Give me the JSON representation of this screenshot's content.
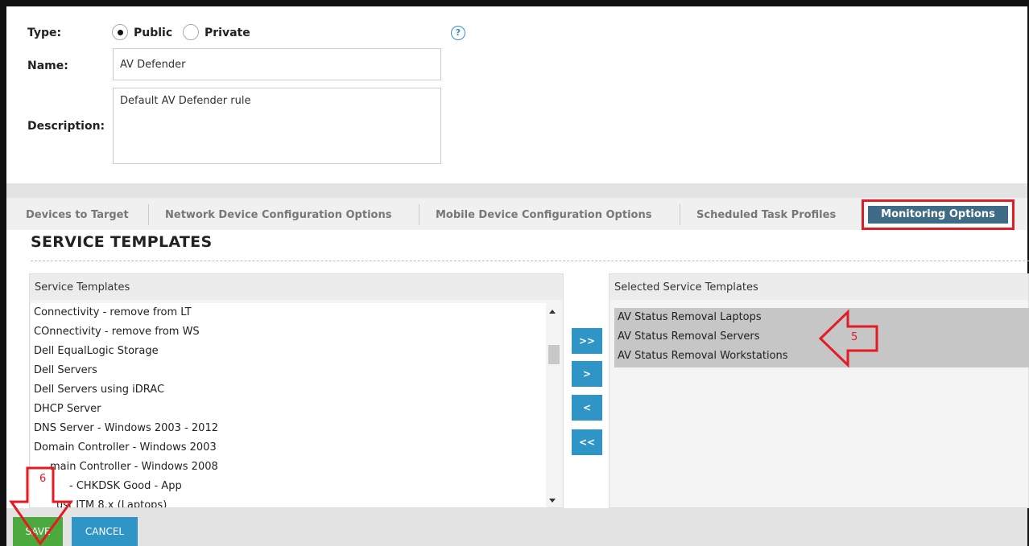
{
  "form": {
    "type_label": "Type:",
    "type_options": [
      "Public",
      "Private"
    ],
    "type_selected": "Public",
    "help_glyph": "?",
    "name_label": "Name:",
    "name_value": "AV Defender",
    "description_label": "Description:",
    "description_value": "Default AV Defender rule"
  },
  "tabs": [
    "Devices to Target",
    "Network Device Configuration Options",
    "Mobile Device Configuration Options",
    "Scheduled Task Profiles",
    "Monitoring Options"
  ],
  "active_tab": "Monitoring Options",
  "section_title": "SERVICE TEMPLATES",
  "available": {
    "header": "Service Templates",
    "items": [
      "Connectivity - remove from LT",
      "COnnectivity - remove from WS",
      "Dell EqualLogic Storage",
      "Dell Servers",
      "Dell Servers using iDRAC",
      "DHCP Server",
      "DNS Server - Windows 2003 - 2012",
      "Domain Controller - Windows 2003",
      "main Controller - Windows 2008",
      "- CHKDSK Good - App",
      "ust ITM 8.x (Laptops)"
    ]
  },
  "move_buttons": {
    "add_all": ">>",
    "add": ">",
    "remove": "<",
    "remove_all": "<<"
  },
  "selected": {
    "header": "Selected Service Templates",
    "items": [
      "AV Status Removal Laptops",
      "AV Status Removal Servers",
      "AV Status Removal Workstations"
    ]
  },
  "actions": {
    "save": "SAVE",
    "cancel": "CANCEL"
  },
  "annotations": {
    "step_5": "5",
    "step_6": "6"
  },
  "colors": {
    "accent_blue": "#2f95c6",
    "tab_active": "#3e6c86",
    "save_green": "#4ca93e",
    "annotation_red": "#e31b23"
  }
}
